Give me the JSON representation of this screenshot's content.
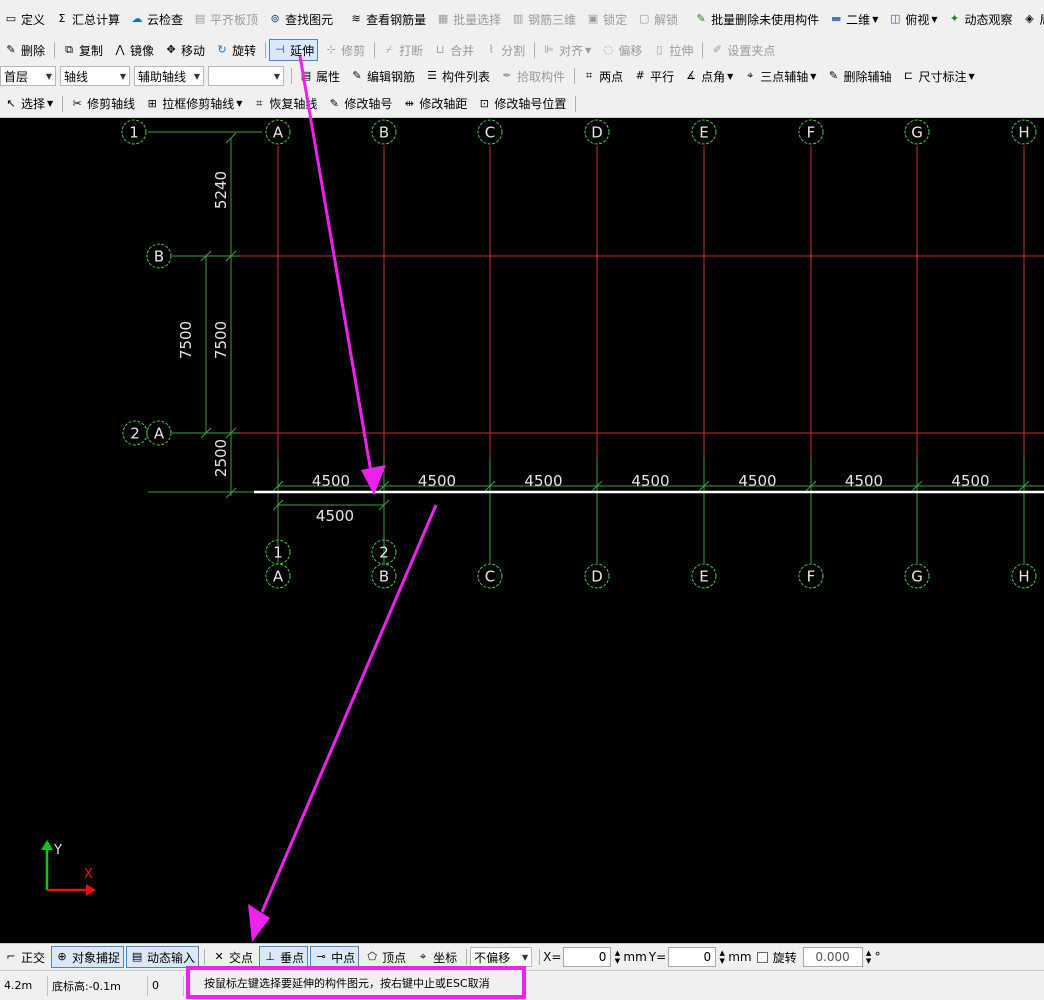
{
  "toolbar1": [
    {
      "label": "定义",
      "icon": "define-icon",
      "disabled": false
    },
    {
      "label": "汇总计算",
      "icon": "sigma-icon",
      "disabled": false
    },
    {
      "label": "云检查",
      "icon": "cloud-check-icon",
      "disabled": false
    },
    {
      "label": "平齐板顶",
      "icon": "align-slab-icon",
      "disabled": true
    },
    {
      "label": "查找图元",
      "icon": "binoculars-icon",
      "disabled": false
    },
    {
      "label": "查看钢筋量",
      "icon": "rebar-quantity-icon",
      "disabled": false
    },
    {
      "label": "批量选择",
      "icon": "batch-select-icon",
      "disabled": true
    },
    {
      "label": "钢筋三维",
      "icon": "rebar-3d-icon",
      "disabled": true
    },
    {
      "label": "锁定",
      "icon": "lock-icon",
      "disabled": true
    },
    {
      "label": "解锁",
      "icon": "unlock-icon",
      "disabled": true
    },
    {
      "label": "批量删除未使用构件",
      "icon": "batch-delete-icon",
      "disabled": false
    },
    {
      "label": "二维",
      "icon": "2d-view-icon",
      "disabled": false,
      "dropdown": true
    },
    {
      "label": "俯视",
      "icon": "top-view-icon",
      "disabled": false,
      "dropdown": true
    },
    {
      "label": "动态观察",
      "icon": "orbit-icon",
      "disabled": false
    },
    {
      "label": "局部",
      "icon": "local-view-icon",
      "disabled": false
    }
  ],
  "toolbar2": [
    {
      "label": "删除",
      "icon": "delete-icon",
      "disabled": false
    },
    {
      "label": "复制",
      "icon": "copy-icon",
      "disabled": false
    },
    {
      "label": "镜像",
      "icon": "mirror-icon",
      "disabled": false
    },
    {
      "label": "移动",
      "icon": "move-icon",
      "disabled": false
    },
    {
      "label": "旋转",
      "icon": "rotate-icon",
      "disabled": false
    },
    {
      "label": "延伸",
      "icon": "extend-icon",
      "disabled": false,
      "active": true
    },
    {
      "label": "修剪",
      "icon": "trim-icon",
      "disabled": true
    },
    {
      "label": "打断",
      "icon": "break-icon",
      "disabled": true
    },
    {
      "label": "合并",
      "icon": "merge-icon",
      "disabled": true
    },
    {
      "label": "分割",
      "icon": "split-icon",
      "disabled": true
    },
    {
      "label": "对齐",
      "icon": "align-icon",
      "disabled": true,
      "dropdown": true
    },
    {
      "label": "偏移",
      "icon": "offset-icon",
      "disabled": true
    },
    {
      "label": "拉伸",
      "icon": "stretch-icon",
      "disabled": true
    },
    {
      "label": "设置夹点",
      "icon": "grip-icon",
      "disabled": true
    }
  ],
  "toolbar3": {
    "floor_combo": "首层",
    "type_combo": "轴线",
    "subtype_combo": "辅助轴线",
    "empty_combo": "",
    "buttons": [
      {
        "label": "属性",
        "icon": "properties-icon",
        "disabled": false
      },
      {
        "label": "编辑钢筋",
        "icon": "edit-rebar-icon",
        "disabled": false
      },
      {
        "label": "构件列表",
        "icon": "component-list-icon",
        "disabled": false
      },
      {
        "label": "拾取构件",
        "icon": "pick-component-icon",
        "disabled": true
      },
      {
        "label": "两点",
        "icon": "two-point-icon",
        "disabled": false
      },
      {
        "label": "平行",
        "icon": "parallel-icon",
        "disabled": false
      },
      {
        "label": "点角",
        "icon": "point-angle-icon",
        "disabled": false,
        "dropdown": true
      },
      {
        "label": "三点辅轴",
        "icon": "three-point-axis-icon",
        "disabled": false,
        "dropdown": true
      },
      {
        "label": "删除辅轴",
        "icon": "delete-axis-icon",
        "disabled": false
      },
      {
        "label": "尺寸标注",
        "icon": "dimension-icon",
        "disabled": false,
        "dropdown": true
      }
    ]
  },
  "toolbar4": [
    {
      "label": "选择",
      "icon": "cursor-icon",
      "disabled": false,
      "dropdown": true
    },
    {
      "label": "修剪轴线",
      "icon": "trim-axis-icon",
      "disabled": false
    },
    {
      "label": "拉框修剪轴线",
      "icon": "box-trim-axis-icon",
      "disabled": false,
      "dropdown": true
    },
    {
      "label": "恢复轴线",
      "icon": "restore-axis-icon",
      "disabled": false
    },
    {
      "label": "修改轴号",
      "icon": "edit-axis-number-icon",
      "disabled": false
    },
    {
      "label": "修改轴距",
      "icon": "edit-axis-spacing-icon",
      "disabled": false
    },
    {
      "label": "修改轴号位置",
      "icon": "edit-axis-position-icon",
      "disabled": false
    }
  ],
  "drawing": {
    "top_col_labels": [
      "1",
      "A",
      "B",
      "C",
      "D",
      "E",
      "F",
      "G",
      "H"
    ],
    "bottom_col_labels_upper": [
      "1",
      "2"
    ],
    "bottom_col_labels_lower": [
      "A",
      "B",
      "C",
      "D",
      "E",
      "F",
      "G",
      "H"
    ],
    "row_labels": [
      "B",
      "2",
      "A"
    ],
    "vertical_dims": [
      "5240",
      "7500",
      "7500",
      "2500"
    ],
    "horizontal_dims": [
      "4500",
      "4500",
      "4500",
      "4500",
      "4500",
      "4500",
      "4500"
    ],
    "sub_dim": "4500",
    "axis_x_label": "X",
    "axis_y_label": "Y",
    "colors": {
      "canvas": "#000000",
      "axis_line": "#c83232",
      "dim_line": "#3ca03c",
      "label": "#e6e6e6",
      "bubble": "#46c846",
      "annotation": "#ee22ee"
    }
  },
  "snapbar": {
    "buttons": [
      {
        "label": "正交",
        "icon": "ortho-icon",
        "active": false
      },
      {
        "label": "对象捕捉",
        "icon": "object-snap-icon",
        "active": true
      },
      {
        "label": "动态输入",
        "icon": "dynamic-input-icon",
        "active": true
      },
      {
        "label": "交点",
        "icon": "intersection-icon",
        "active": false
      },
      {
        "label": "垂点",
        "icon": "perpendicular-icon",
        "active": true
      },
      {
        "label": "中点",
        "icon": "midpoint-icon",
        "active": true
      },
      {
        "label": "顶点",
        "icon": "vertex-icon",
        "active": false
      },
      {
        "label": "坐标",
        "icon": "coordinate-icon",
        "active": false
      }
    ],
    "offset_combo": "不偏移",
    "x_label": "X=",
    "x_value": "0",
    "y_label": "Y=",
    "y_value": "0",
    "unit": "mm",
    "rotate_label": "旋转",
    "rotate_value": "0.000",
    "degree": "°"
  },
  "statusbar": {
    "layer_height": "4.2m",
    "base_height": "底标高:-0.1m",
    "count": "0",
    "prompt": "按鼠标左键选择要延伸的构件图元，按右键中止或ESC取消"
  }
}
